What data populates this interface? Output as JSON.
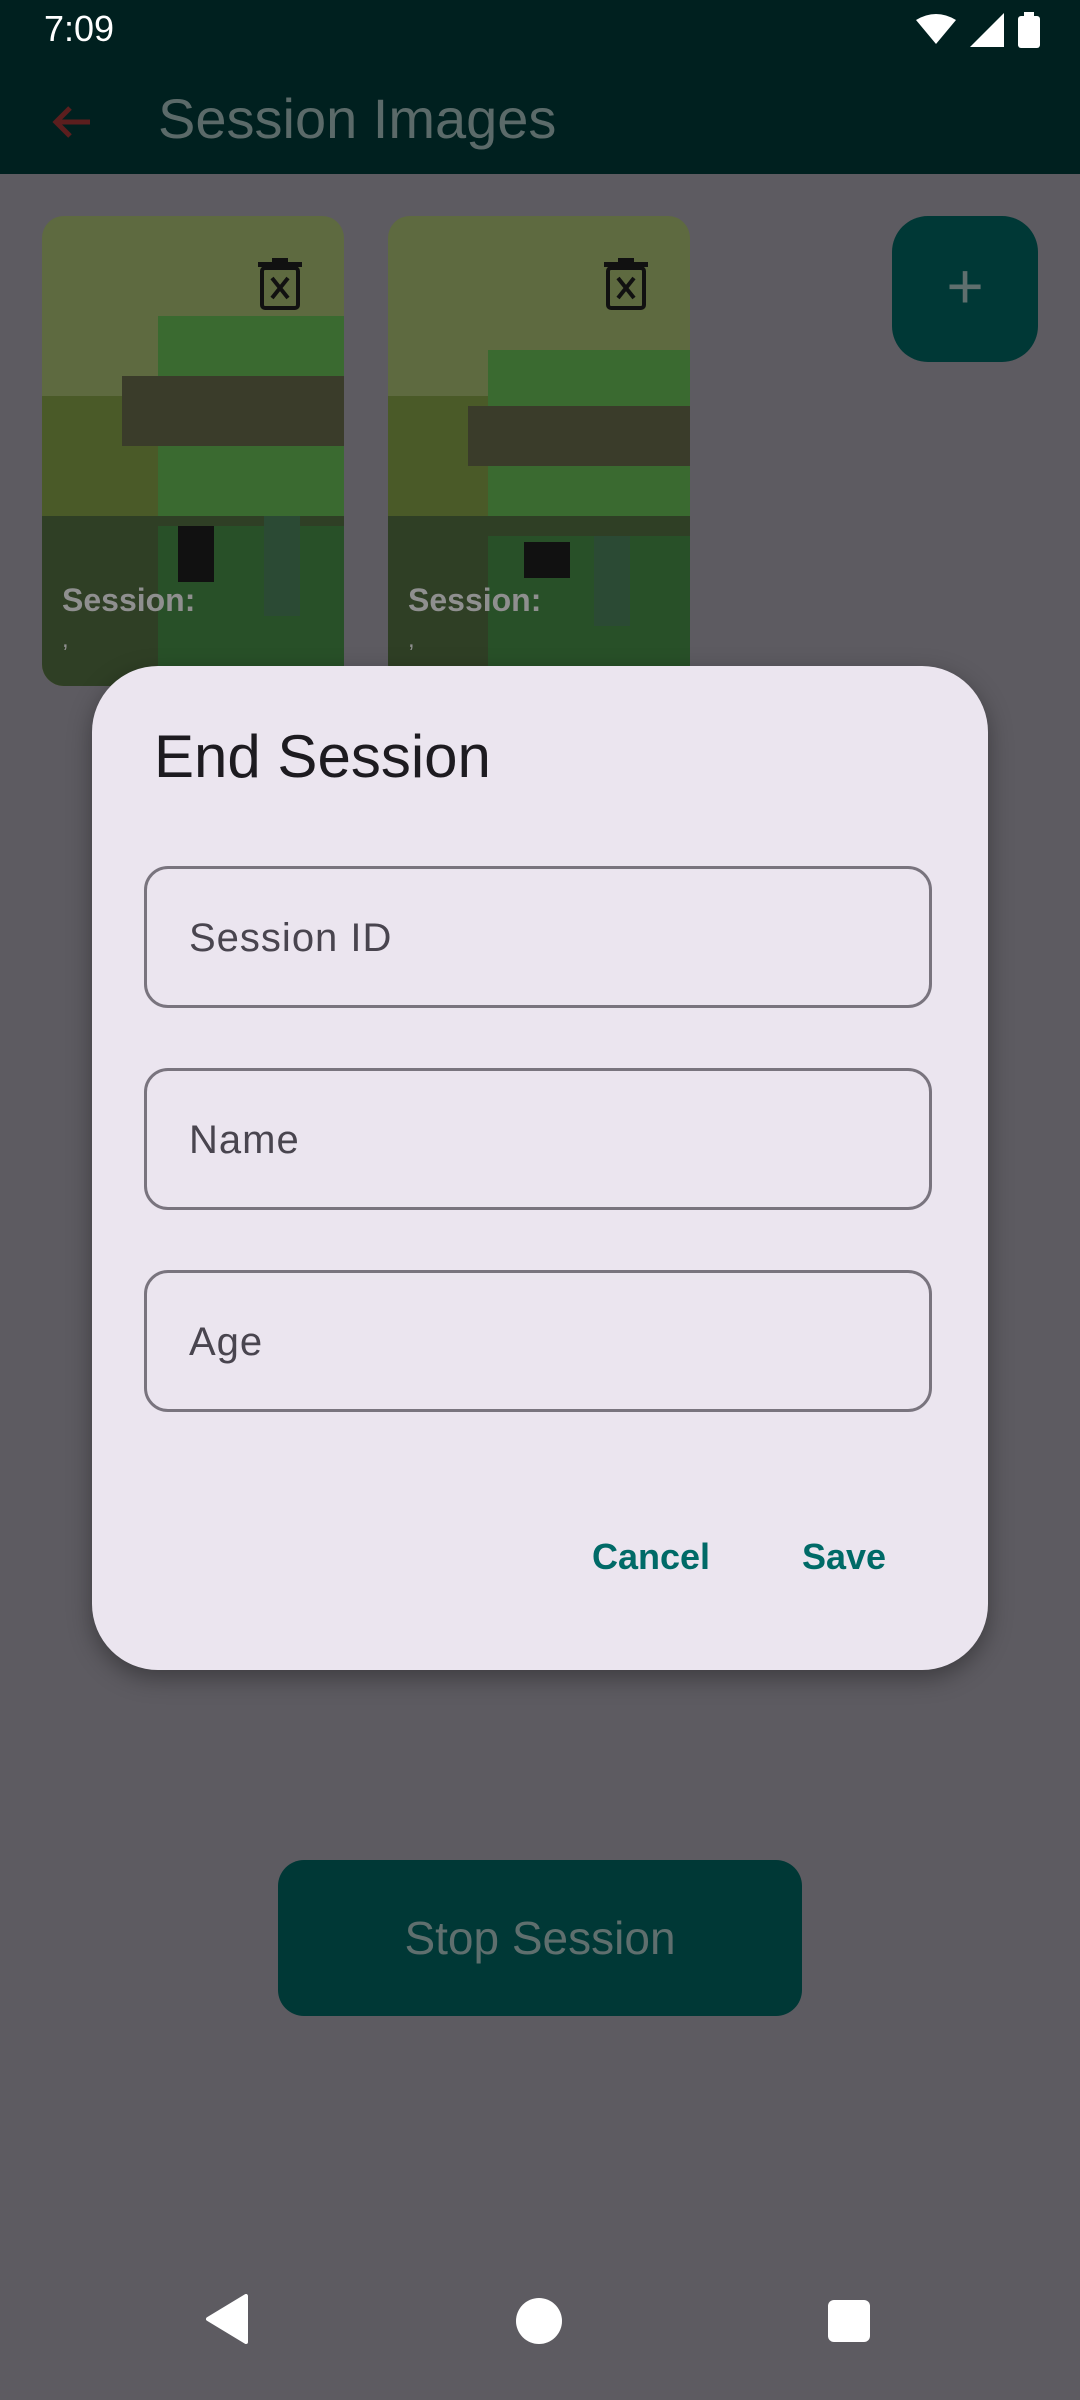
{
  "status_bar": {
    "time": "7:09",
    "icons": [
      "wifi-icon",
      "signal-icon",
      "battery-icon"
    ]
  },
  "app_bar": {
    "title": "Session Images",
    "back_icon": "arrow-back-icon"
  },
  "images": [
    {
      "label": "Session:",
      "sub": ",",
      "delete_icon": "delete-icon"
    },
    {
      "label": "Session:",
      "sub": ",",
      "delete_icon": "delete-icon"
    }
  ],
  "fab": {
    "icon": "plus-icon",
    "symbol": "+"
  },
  "stop_button": {
    "label": "Stop Session"
  },
  "dialog": {
    "title": "End Session",
    "fields": [
      {
        "placeholder": "Session ID",
        "value": ""
      },
      {
        "placeholder": "Name",
        "value": ""
      },
      {
        "placeholder": "Age",
        "value": ""
      }
    ],
    "cancel_label": "Cancel",
    "save_label": "Save"
  },
  "nav_bar": {
    "icons": [
      "nav-back-icon",
      "nav-home-icon",
      "nav-recents-icon"
    ]
  },
  "colors": {
    "primary": "#006a67",
    "app_bar": "#00201f",
    "scrim": "#5d5b61",
    "dialog": "#ebe5ef"
  }
}
